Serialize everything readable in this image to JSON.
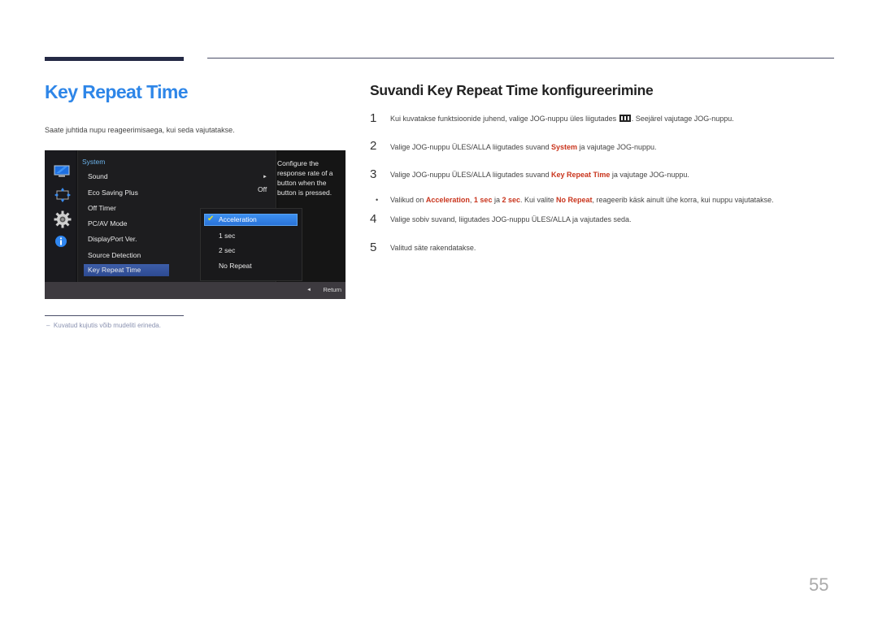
{
  "left": {
    "title": "Key Repeat Time",
    "description": "Saate juhtida nupu reageerimisaega, kui seda vajutatakse.",
    "footnote_dash": "–",
    "footnote": "Kuvatud kujutis võib mudeliti erineda."
  },
  "osd": {
    "category": "System",
    "items": [
      {
        "label": "Sound"
      },
      {
        "label": "Eco Saving Plus"
      },
      {
        "label": "Off Timer"
      },
      {
        "label": "PC/AV Mode"
      },
      {
        "label": "DisplayPort Ver."
      },
      {
        "label": "Source Detection"
      },
      {
        "label": "Key Repeat Time"
      }
    ],
    "sound_arrow": "►",
    "eco_value": "Off",
    "submenu": [
      {
        "label": "Acceleration",
        "selected": true
      },
      {
        "label": "1 sec"
      },
      {
        "label": "2 sec"
      },
      {
        "label": "No Repeat"
      }
    ],
    "check_glyph": "✔",
    "help_text": "Configure the response rate of a button when the button is pressed.",
    "return_icon": "◄",
    "return_label": "Return",
    "icons": [
      "monitor-icon",
      "position-icon",
      "gear-icon",
      "info-icon"
    ]
  },
  "right": {
    "title": "Suvandi Key Repeat Time konfigureerimine",
    "steps": [
      {
        "num": "1",
        "pre": "Kui kuvatakse funktsioonide juhend, valige JOG-nuppu üles liigutades ",
        "post": ". Seejärel vajutage JOG-nuppu."
      },
      {
        "num": "2",
        "pre": "Valige JOG-nuppu ÜLES/ALLA liigutades suvand ",
        "hl": "System",
        "post": " ja vajutage JOG-nuppu."
      },
      {
        "num": "3",
        "pre": "Valige JOG-nuppu ÜLES/ALLA liigutades suvand ",
        "hl": "Key Repeat Time",
        "post": " ja vajutage JOG-nuppu."
      },
      {
        "num": "4",
        "text": "Valige sobiv suvand, liigutades JOG-nuppu ÜLES/ALLA ja vajutades seda."
      },
      {
        "num": "5",
        "text": "Valitud säte rakendatakse."
      }
    ],
    "note": {
      "bullet": "•",
      "t1": "Valikud on ",
      "h1": "Acceleration",
      "t2": ", ",
      "h2": "1 sec",
      "t3": " ja ",
      "h3": "2 sec",
      "t4": ". Kui valite ",
      "h4": "No Repeat",
      "t5": ", reageerib käsk ainult ühe korra, kui nuppu vajutatakse."
    }
  },
  "page_number": "55",
  "colors": {
    "title_blue": "#2e86e8",
    "highlight_red": "#c9341c",
    "osd_selection": "#3d5ea8",
    "osd_submenu_selection": "#3c8ff0"
  }
}
